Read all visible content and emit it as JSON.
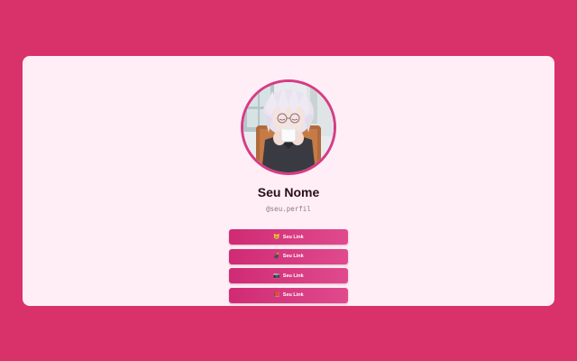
{
  "profile": {
    "name": "Seu Nome",
    "handle": "@seu.perfil",
    "avatar_icon": "anime-avatar-photo"
  },
  "links": [
    {
      "emoji": "😸",
      "label": "Seu Link",
      "icon": "cat-emoji-icon"
    },
    {
      "emoji": "💣",
      "label": "Seu Link",
      "icon": "bomb-emoji-icon"
    },
    {
      "emoji": "📷",
      "label": "Seu Link",
      "icon": "camera-emoji-icon"
    },
    {
      "emoji": "📕",
      "label": "Seu Link",
      "icon": "book-emoji-icon"
    }
  ],
  "colors": {
    "page_background": "#d9316a",
    "card_background": "#ffeef6",
    "button": "#d63c86",
    "avatar_ring": "#d63c86"
  }
}
